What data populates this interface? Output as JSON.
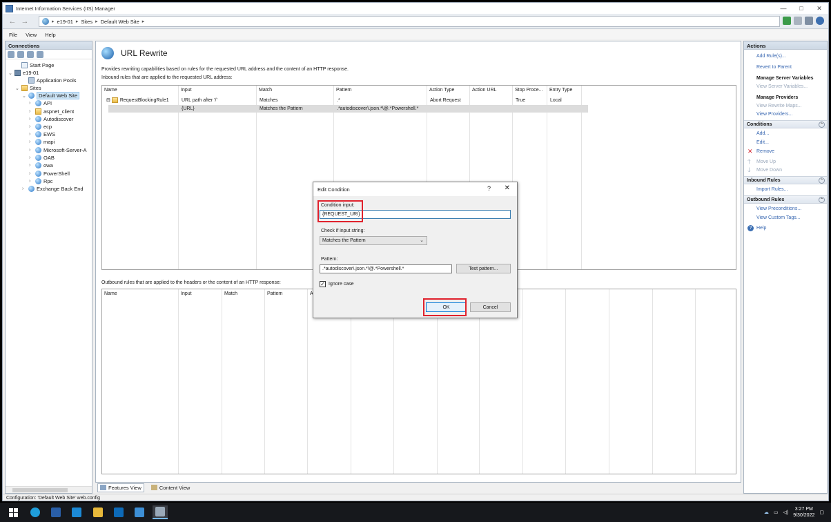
{
  "window": {
    "title": "Internet Information Services (IIS) Manager",
    "controls": [
      "—",
      "□",
      "✕"
    ]
  },
  "address": {
    "segments": [
      "e19-01",
      "Sites",
      "Default Web Site"
    ]
  },
  "menu": [
    "File",
    "View",
    "Help"
  ],
  "connections": {
    "title": "Connections",
    "tree": [
      {
        "label": "Start Page",
        "icon": "page-icon",
        "indent": 1,
        "exp": ""
      },
      {
        "label": "e19-01",
        "icon": "server-icon",
        "indent": 0,
        "exp": "⌄"
      },
      {
        "label": "Application Pools",
        "icon": "pools-icon",
        "indent": 2,
        "exp": ""
      },
      {
        "label": "Sites",
        "icon": "folder-icon",
        "indent": 1,
        "exp": "⌄"
      },
      {
        "label": "Default Web Site",
        "icon": "globe-icon",
        "indent": 2,
        "exp": "⌄",
        "selected": true
      },
      {
        "label": "API",
        "icon": "globe-icon",
        "indent": 3,
        "exp": "›"
      },
      {
        "label": "aspnet_client",
        "icon": "folder-icon",
        "indent": 3,
        "exp": "›"
      },
      {
        "label": "Autodiscover",
        "icon": "globe-icon",
        "indent": 3,
        "exp": "›"
      },
      {
        "label": "ecp",
        "icon": "globe-icon",
        "indent": 3,
        "exp": "›"
      },
      {
        "label": "EWS",
        "icon": "globe-icon",
        "indent": 3,
        "exp": "›"
      },
      {
        "label": "mapi",
        "icon": "globe-icon",
        "indent": 3,
        "exp": "›"
      },
      {
        "label": "Microsoft-Server-A",
        "icon": "globe-icon",
        "indent": 3,
        "exp": "›"
      },
      {
        "label": "OAB",
        "icon": "globe-icon",
        "indent": 3,
        "exp": "›"
      },
      {
        "label": "owa",
        "icon": "globe-icon",
        "indent": 3,
        "exp": "›"
      },
      {
        "label": "PowerShell",
        "icon": "globe-icon",
        "indent": 3,
        "exp": "›"
      },
      {
        "label": "Rpc",
        "icon": "globe-icon",
        "indent": 3,
        "exp": "›"
      },
      {
        "label": "Exchange Back End",
        "icon": "globe-icon",
        "indent": 2,
        "exp": "›"
      }
    ]
  },
  "feature": {
    "title": "URL Rewrite",
    "description": "Provides rewriting capabilities based on rules for the requested URL address and the content of an HTTP response.",
    "inbound_label": "Inbound rules that are applied to the requested URL address:",
    "inbound_headers": [
      "Name",
      "Input",
      "Match",
      "Pattern",
      "Action Type",
      "Action URL",
      "Stop Proce...",
      "Entry Type"
    ],
    "inbound_rows": [
      [
        "RequestBlockingRule1",
        "URL path after '/'",
        "Matches",
        ".*",
        "Abort Request",
        "",
        "True",
        "Local"
      ],
      [
        "",
        "{URL}",
        "Matches the Pattern",
        ".*autodiscover\\.json.*\\@.*Powershell.*",
        "",
        "",
        "",
        ""
      ]
    ],
    "outbound_label": "Outbound rules that are applied to the headers or the content of an HTTP response:",
    "outbound_headers": [
      "Name",
      "Input",
      "Match",
      "Pattern",
      "Ac"
    ]
  },
  "bottom_tabs": {
    "features_view": "Features View",
    "content_view": "Content View"
  },
  "actions": {
    "title": "Actions",
    "add_rules": "Add Rule(s)...",
    "revert": "Revert to Parent",
    "manage_server_vars": "Manage Server Variables",
    "view_server_vars": "View Server Variables...",
    "manage_providers": "Manage Providers",
    "view_rewrite_maps": "View Rewrite Maps...",
    "view_providers": "View Providers...",
    "conditions": "Conditions",
    "add": "Add...",
    "edit": "Edit...",
    "remove": "Remove",
    "move_up": "Move Up",
    "move_down": "Move Down",
    "inbound_rules": "Inbound Rules",
    "import_rules": "Import Rules...",
    "outbound_rules": "Outbound Rules",
    "view_preconditions": "View Preconditions...",
    "view_custom_tags": "View Custom Tags...",
    "help": "Help"
  },
  "status": "Configuration: 'Default Web Site' web.config",
  "dialog": {
    "title": "Edit Condition",
    "help_glyph": "?",
    "close_glyph": "✕",
    "condition_input_label": "Condition input:",
    "condition_input_value": "{REQUEST_URI}",
    "check_label": "Check if input string:",
    "check_value": "Matches the Pattern",
    "pattern_label": "Pattern:",
    "pattern_value": ".*autodiscover\\.json.*\\@.*Powershell.*",
    "test_pattern": "Test pattern...",
    "ignore_case": "Ignore case",
    "ignore_case_checked": true,
    "ok": "OK",
    "cancel": "Cancel"
  },
  "taskbar": {
    "time": "3:27 PM",
    "date": "9/30/2022",
    "apps": [
      "windows-start-icon",
      "edge-icon",
      "powershell-icon",
      "vscode-icon",
      "file-explorer-icon",
      "outlook-icon",
      "remote-desktop-icon",
      "iis-manager-icon"
    ]
  },
  "colors": {
    "accent": "#0078d7",
    "highlight_red": "#e0212c",
    "link": "#3766b0"
  }
}
